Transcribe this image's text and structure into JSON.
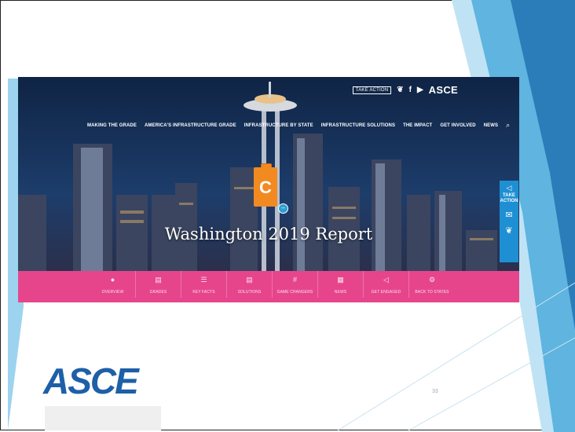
{
  "site": {
    "top_bar": {
      "take_action": "TAKE ACTION",
      "twitter_glyph": "❦",
      "facebook_glyph": "f",
      "youtube_glyph": "▶",
      "brand": "ASCE"
    },
    "nav": {
      "items": [
        "MAKING THE GRADE",
        "AMERICA'S INFRASTRUCTURE GRADE",
        "INFRASTRUCTURE BY STATE",
        "INFRASTRUCTURE SOLUTIONS",
        "THE IMPACT",
        "GET INVOLVED",
        "NEWS"
      ],
      "search_glyph": "⌕"
    },
    "hero": {
      "title": "Washington 2019 Report",
      "grade": "C",
      "grade_modifier": "–"
    },
    "side_panel": {
      "label_line1": "TAKE",
      "label_line2": "ACTION",
      "email_glyph": "✉",
      "twitter_glyph": "❦",
      "megaphone_glyph": "◁"
    },
    "subnav": {
      "items": [
        {
          "label": "OVERVIEW",
          "icon": "●"
        },
        {
          "label": "GRADES",
          "icon": "▤"
        },
        {
          "label": "KEY FACTS",
          "icon": "☰"
        },
        {
          "label": "SOLUTIONS",
          "icon": "▤"
        },
        {
          "label": "GAME CHANGERS",
          "icon": "#"
        },
        {
          "label": "NEWS",
          "icon": "▦"
        },
        {
          "label": "GET ENGAGED",
          "icon": "◁"
        },
        {
          "label": "BACK TO STATES",
          "icon": "⚙"
        }
      ]
    }
  },
  "slide": {
    "logo_text": "ASCE",
    "page_number": "33"
  },
  "colors": {
    "subnav_pink": "#e6458c",
    "grade_orange": "#f28a22",
    "side_blue": "#1e8fd3",
    "logo_blue": "#1e5fa8"
  }
}
